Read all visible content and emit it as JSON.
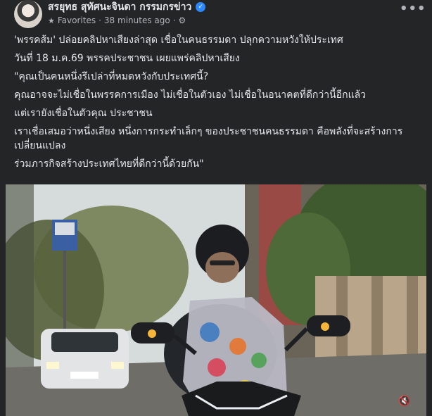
{
  "post": {
    "author": "สรยุทธ สุทัศนะจินดา กรรมกรข่าว",
    "audience": "Favorites",
    "separator": "·",
    "timestamp": "38 minutes ago",
    "separator2": "·",
    "icons": {
      "star": "star-icon",
      "globe": "gear-icon",
      "verified": "verified-badge-icon",
      "more": "more-options-icon",
      "mute": "volume-muted-icon"
    },
    "verified_glyph": "✓",
    "more_glyph": "•••",
    "lines": [
      "'พรรคส้ม' ปล่อยคลิปหาเสียงล่าสุด เชื่อในคนธรรมดา ปลุกความหวังให้ประเทศ",
      "วันที่ 18 ม.ค.69 พรรคประชาชน เผยแพร่คลิปหาเสียง",
      "\"คุณเป็นคนหนึ่งรึเปล่าที่หมดหวังกับประเทศนี้?",
      "คุณอาจจะไม่เชื่อในพรรคการเมือง ไม่เชื่อในตัวเอง ไม่เชื่อในอนาคตที่ดีกว่านี้อีกแล้ว",
      "แต่เรายังเชื่อในตัวคุณ ประชาชน",
      "เราเชื่อเสมอว่าหนึ่งเสียง หนึ่งการกระทำเล็กๆ ของประชาชนคนธรรมดา คือพลังที่จะสร้างการเปลี่ยนแปลง",
      "ร่วมภารกิจสร้างประเทศไทยที่ดีกว่านี้ด้วยกัน\""
    ]
  },
  "colors": {
    "background": "#242526",
    "text": "#e4e6eb",
    "meta": "#b0b3b8",
    "verified": "#2d88ff"
  }
}
